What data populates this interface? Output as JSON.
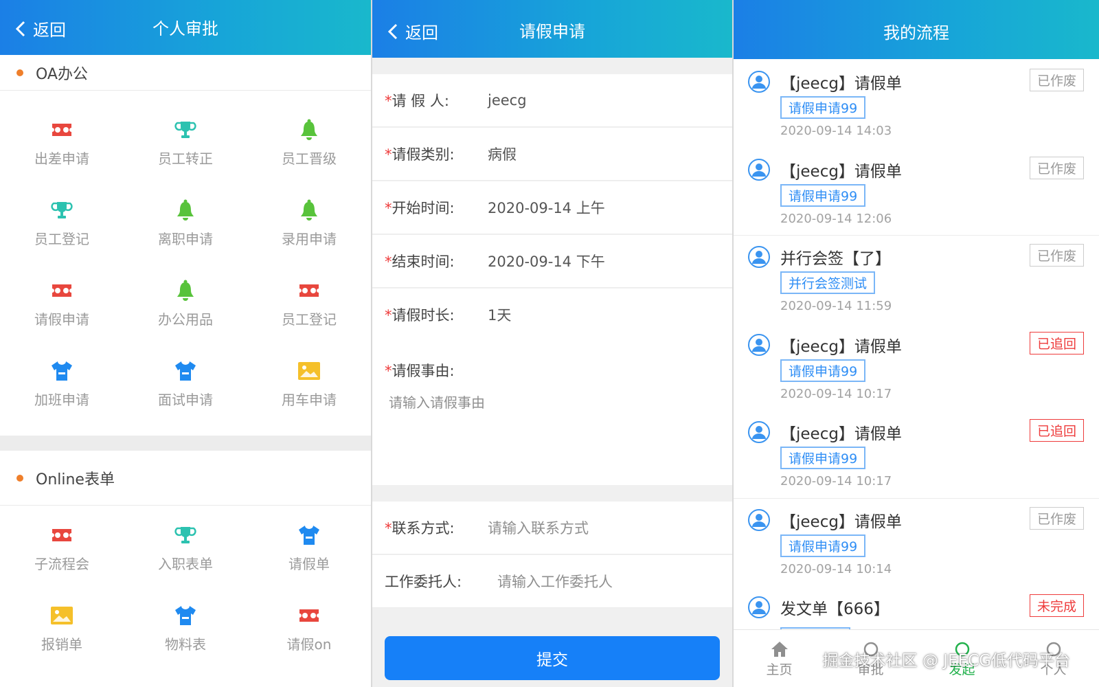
{
  "approval": {
    "back_label": "返回",
    "title": "个人审批",
    "oa_section": {
      "title": "OA办公",
      "items": [
        {
          "label": "出差申请",
          "icon": "ticket-icon",
          "color": "#e8473e"
        },
        {
          "label": "员工转正",
          "icon": "trophy-icon",
          "color": "#2cc2b0"
        },
        {
          "label": "员工晋级",
          "icon": "bell-icon",
          "color": "#58c33b"
        },
        {
          "label": "员工登记",
          "icon": "trophy-icon",
          "color": "#2cc2b0"
        },
        {
          "label": "离职申请",
          "icon": "bell-icon",
          "color": "#58c33b"
        },
        {
          "label": "录用申请",
          "icon": "bell-icon",
          "color": "#58c33b"
        },
        {
          "label": "请假申请",
          "icon": "ticket-icon",
          "color": "#e8473e"
        },
        {
          "label": "办公用品",
          "icon": "bell-icon",
          "color": "#58c33b"
        },
        {
          "label": "员工登记",
          "icon": "ticket-icon",
          "color": "#e8473e"
        },
        {
          "label": "加班申请",
          "icon": "shirt-icon",
          "color": "#1f8af0"
        },
        {
          "label": "面试申请",
          "icon": "shirt-icon",
          "color": "#1f8af0"
        },
        {
          "label": "用车申请",
          "icon": "image-icon",
          "color": "#f5c02a"
        }
      ]
    },
    "online_section": {
      "title": "Online表单",
      "items": [
        {
          "label": "子流程会",
          "icon": "ticket-icon",
          "color": "#e8473e"
        },
        {
          "label": "入职表单",
          "icon": "trophy-icon",
          "color": "#2cc2b0"
        },
        {
          "label": "请假单",
          "icon": "shirt-icon",
          "color": "#1f8af0"
        },
        {
          "label": "报销单",
          "icon": "image-icon",
          "color": "#f5c02a"
        },
        {
          "label": "物料表",
          "icon": "shirt-icon",
          "color": "#1f8af0"
        },
        {
          "label": "请假on",
          "icon": "ticket-icon",
          "color": "#e8473e"
        }
      ]
    }
  },
  "leave_form": {
    "back_label": "返回",
    "title": "请假申请",
    "applicant_label": "请 假 人:",
    "applicant_value": "jeecg",
    "type_label": "请假类别:",
    "type_value": "病假",
    "start_label": "开始时间:",
    "start_value": "2020-09-14 上午",
    "end_label": "结束时间:",
    "end_value": "2020-09-14 下午",
    "duration_label": "请假时长:",
    "duration_value": "1天",
    "reason_label": "请假事由:",
    "reason_placeholder": "请输入请假事由",
    "contact_label": "联系方式:",
    "contact_placeholder": "请输入联系方式",
    "delegate_label": "工作委托人:",
    "delegate_placeholder": "请输入工作委托人",
    "required_mark": "*",
    "submit_label": "提交"
  },
  "my_process": {
    "title": "我的流程",
    "items": [
      {
        "title": "【jeecg】请假单",
        "tag": "请假申请99",
        "time": "2020-09-14 14:03",
        "status": "已作废",
        "status_type": "gray"
      },
      {
        "title": "【jeecg】请假单",
        "tag": "请假申请99",
        "time": "2020-09-14 12:06",
        "status": "已作废",
        "status_type": "gray"
      },
      {
        "title": "并行会签【了】",
        "tag": "并行会签测试",
        "time": "2020-09-14 11:59",
        "status": "已作废",
        "status_type": "gray"
      },
      {
        "title": "【jeecg】请假单",
        "tag": "请假申请99",
        "time": "2020-09-14 10:17",
        "status": "已追回",
        "status_type": "red"
      },
      {
        "title": "【jeecg】请假单",
        "tag": "请假申请99",
        "time": "2020-09-14 10:17",
        "status": "已追回",
        "status_type": "red"
      },
      {
        "title": "【jeecg】请假单",
        "tag": "请假申请99",
        "time": "2020-09-14 10:14",
        "status": "已作废",
        "status_type": "gray"
      },
      {
        "title": "发文单【666】",
        "tag": "",
        "time": "",
        "status": "未完成",
        "status_type": "red"
      }
    ],
    "tabs": [
      {
        "label": "主页",
        "icon": "home-icon"
      },
      {
        "label": "审批",
        "icon": "circle-icon"
      },
      {
        "label": "发起",
        "icon": "circle-icon",
        "active": true
      },
      {
        "label": "个人",
        "icon": "circle-icon"
      }
    ],
    "watermark": "掘金技术社区 @ JEECG低代码平台"
  }
}
